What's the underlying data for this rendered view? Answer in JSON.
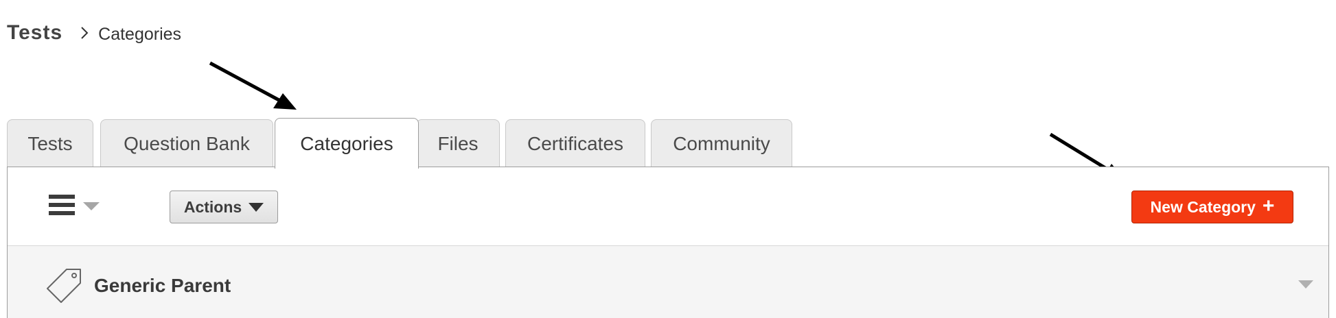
{
  "breadcrumb": {
    "root": "Tests",
    "current": "Categories"
  },
  "tabs": [
    {
      "label": "Tests",
      "active": false
    },
    {
      "label": "Question Bank",
      "active": false
    },
    {
      "label": "Categories",
      "active": true
    },
    {
      "label": "Files",
      "active": false
    },
    {
      "label": "Certificates",
      "active": false
    },
    {
      "label": "Community",
      "active": false
    }
  ],
  "toolbar": {
    "menu_icon": "hamburger-icon",
    "actions_label": "Actions",
    "new_category_label": "New Category",
    "new_category_icon": "plus-icon",
    "new_category_color": "#f33a12"
  },
  "categories": [
    {
      "icon": "tag-icon",
      "name": "Generic Parent"
    }
  ]
}
